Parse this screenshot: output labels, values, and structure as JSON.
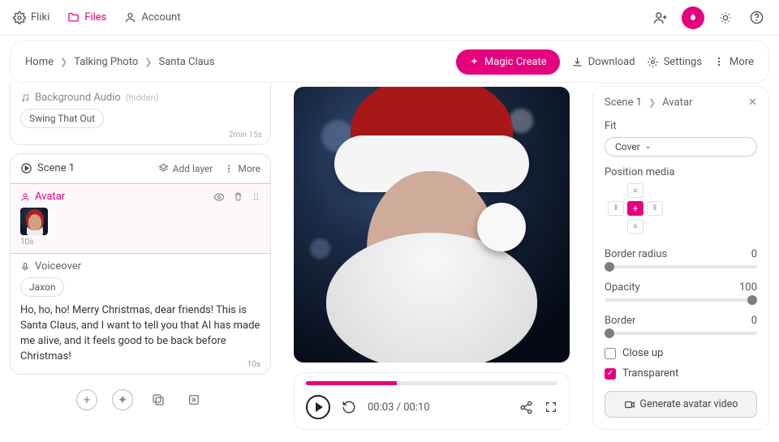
{
  "app": {
    "name": "Fliki",
    "nav_files": "Files",
    "nav_account": "Account"
  },
  "breadcrumb": {
    "home": "Home",
    "project": "Talking Photo",
    "file": "Santa Claus"
  },
  "toolbar": {
    "magic": "Magic Create",
    "download": "Download",
    "settings": "Settings",
    "more": "More"
  },
  "bg_audio": {
    "title": "Background Audio",
    "hidden": "(hidden)",
    "track": "Swing That Out",
    "duration_total": "2min 15s"
  },
  "scene": {
    "title": "Scene 1",
    "add_layer": "Add layer",
    "more": "More",
    "avatar_label": "Avatar",
    "avatar_duration": "10s",
    "voiceover_label": "Voiceover",
    "voice_name": "Jaxon",
    "script": "Ho, ho, ho! Merry Christmas, dear friends! This is Santa Claus, and I want to tell you that AI has made me alive, and it feels good to be back before Christmas!",
    "vo_duration": "10s"
  },
  "player": {
    "current": "00:03",
    "total": "00:10",
    "progress_pct": 36
  },
  "panel": {
    "bc_scene": "Scene 1",
    "bc_layer": "Avatar",
    "fit_label": "Fit",
    "fit_value": "Cover",
    "pos_label": "Position media",
    "border_radius_label": "Border radius",
    "border_radius_value": "0",
    "opacity_label": "Opacity",
    "opacity_value": "100",
    "border_label": "Border",
    "border_value": "0",
    "closeup_label": "Close up",
    "closeup_checked": false,
    "transparent_label": "Transparent",
    "transparent_checked": true,
    "generate": "Generate avatar video"
  }
}
